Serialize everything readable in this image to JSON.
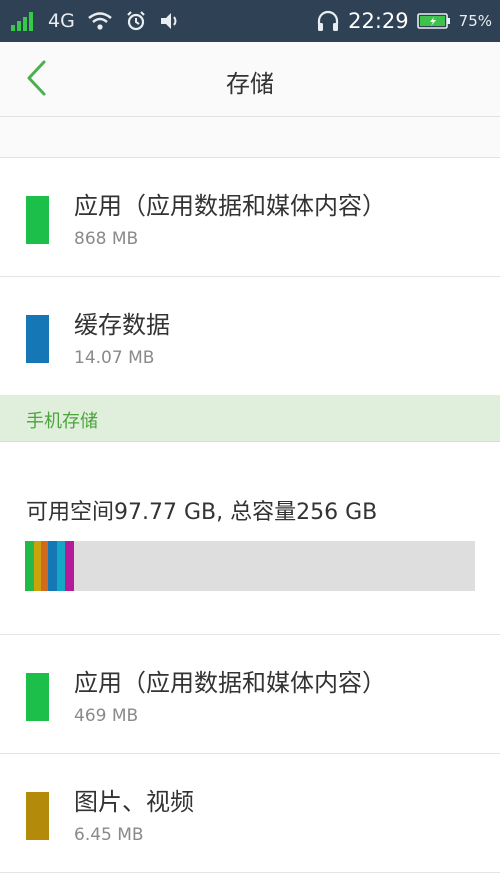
{
  "status_bar": {
    "network": "4G",
    "time": "22:29",
    "battery": "75%",
    "icons": [
      "signal-icon",
      "wifi-icon",
      "alarm-icon",
      "volume-icon",
      "headphones-icon",
      "battery-icon"
    ]
  },
  "header": {
    "title": "存储",
    "back_icon": "back-arrow-icon",
    "accent": "#4caf50"
  },
  "rows_top": [
    {
      "label": "应用（应用数据和媒体内容）",
      "size": "868 MB",
      "color": "#1bbf4a"
    },
    {
      "label": "缓存数据",
      "size": "14.07 MB",
      "color": "#1577b5"
    }
  ],
  "section": {
    "label": "手机存储"
  },
  "summary": {
    "text": "可用空间97.77 GB, 总容量256 GB",
    "segments": [
      {
        "color": "#22b84a",
        "fraction": 0.02
      },
      {
        "color": "#c9a20c",
        "fraction": 0.016
      },
      {
        "color": "#d2691e",
        "fraction": 0.016
      },
      {
        "color": "#1577b5",
        "fraction": 0.02
      },
      {
        "color": "#14a6c4",
        "fraction": 0.018
      },
      {
        "color": "#b51a9b",
        "fraction": 0.02
      }
    ]
  },
  "rows_bottom": [
    {
      "label": "应用（应用数据和媒体内容）",
      "size": "469 MB",
      "color": "#1bbf4a"
    },
    {
      "label": "图片、视频",
      "size": "6.45 MB",
      "color": "#b38a0a"
    }
  ]
}
